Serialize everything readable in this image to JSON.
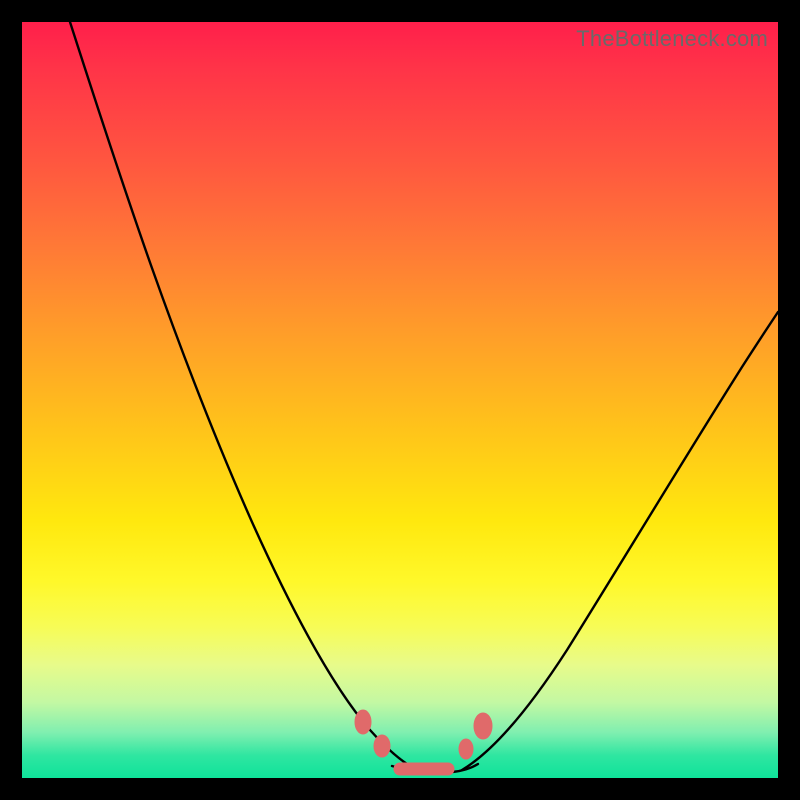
{
  "watermark": "TheBottleneck.com",
  "colors": {
    "frame": "#000000",
    "gradient_top": "#ff1f4b",
    "gradient_bottom": "#0fe39a",
    "marker": "#e06a6a",
    "curve": "#000000"
  },
  "chart_data": {
    "type": "line",
    "title": "",
    "xlabel": "",
    "ylabel": "",
    "xlim": [
      0,
      100
    ],
    "ylim": [
      0,
      100
    ],
    "annotations": [],
    "notes": "Bottleneck-style V-curve on rainbow gradient; two black curves descending from top edges into a flat trough near the bottom, with small salmon markers flanking and spanning the trough.",
    "series": [
      {
        "name": "left-branch",
        "x": [
          6,
          14,
          22,
          30,
          36,
          42,
          46,
          50
        ],
        "y": [
          100,
          79,
          58,
          38,
          24,
          12,
          5,
          1
        ]
      },
      {
        "name": "right-branch",
        "x": [
          56,
          60,
          66,
          74,
          84,
          94,
          100
        ],
        "y": [
          1,
          5,
          14,
          28,
          44,
          58,
          66
        ]
      },
      {
        "name": "trough",
        "x": [
          46,
          48,
          50,
          52,
          54,
          56,
          58,
          60
        ],
        "y": [
          5,
          2,
          1,
          1,
          1,
          1,
          2,
          5
        ]
      }
    ],
    "markers": [
      {
        "name": "left-upper-dot",
        "x": 45.0,
        "y": 6.5
      },
      {
        "name": "left-lower-dot",
        "x": 47.5,
        "y": 3.5
      },
      {
        "name": "right-upper-dot",
        "x": 60.7,
        "y": 6.0
      },
      {
        "name": "right-lower-dot",
        "x": 58.4,
        "y": 3.0
      },
      {
        "name": "trough-pill",
        "x0": 49.0,
        "x1": 57.0,
        "y": 1.2
      }
    ]
  }
}
